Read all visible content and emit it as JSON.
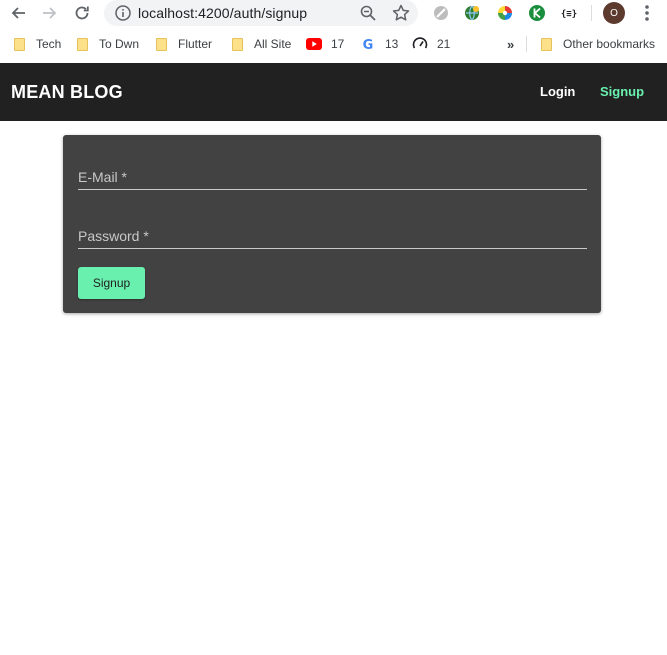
{
  "browser": {
    "url": "localhost:4200/auth/signup",
    "avatar_letter": "O",
    "bookmarks": [
      {
        "label": "Tech",
        "icon": "folder-icon"
      },
      {
        "label": "To Dwn",
        "icon": "folder-icon"
      },
      {
        "label": "Flutter",
        "icon": "folder-icon"
      },
      {
        "label": "All Site",
        "icon": "folder-icon"
      },
      {
        "label": "17",
        "icon": "youtube-icon"
      },
      {
        "label": "13",
        "icon": "google-icon"
      },
      {
        "label": "21",
        "icon": "speedometer-icon"
      }
    ],
    "more_bookmarks": "»",
    "other_bookmarks": "Other bookmarks"
  },
  "app": {
    "brand": "MEAN BLOG",
    "nav": {
      "login": "Login",
      "signup": "Signup"
    },
    "colors": {
      "navbar": "#212121",
      "accent": "#69f0ae",
      "card": "#424242"
    }
  },
  "form": {
    "email_label": "E-Mail *",
    "email_value": "",
    "password_label": "Password *",
    "password_value": "",
    "submit_label": "Signup"
  }
}
